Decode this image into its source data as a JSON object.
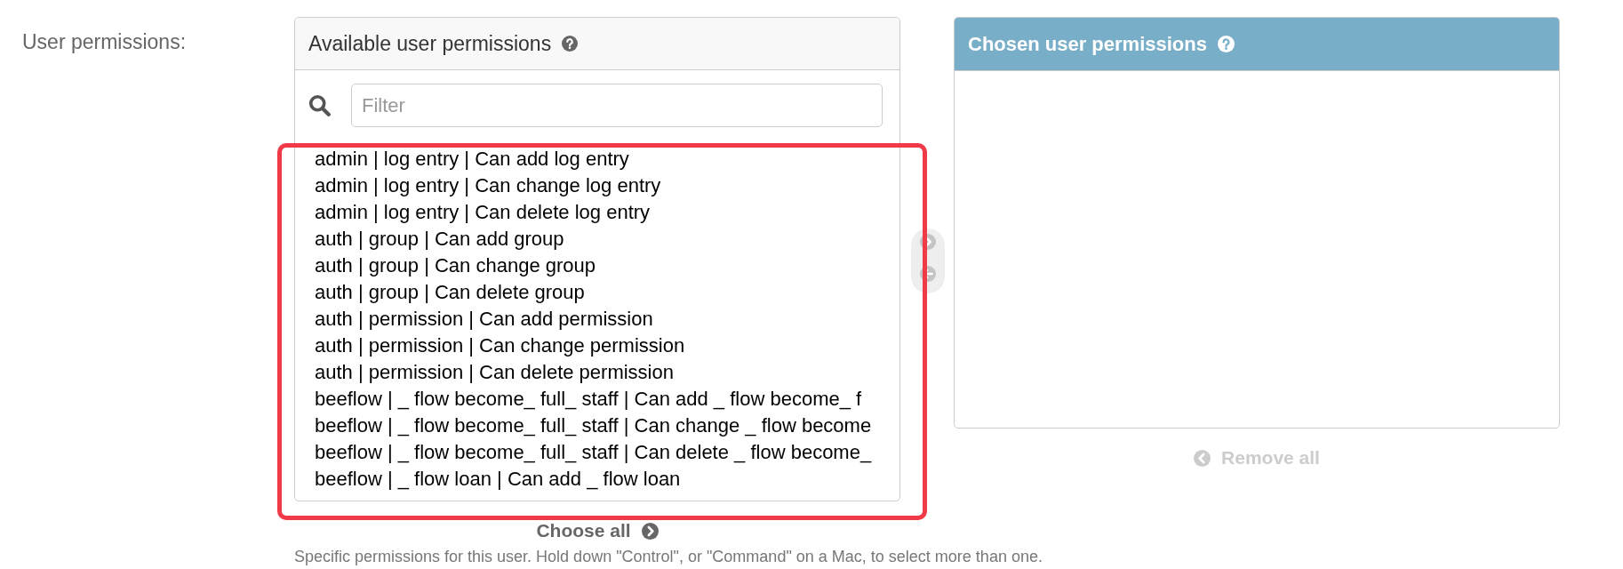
{
  "field": {
    "label": "User permissions:"
  },
  "available": {
    "title": "Available user permissions",
    "filter": {
      "placeholder": "Filter"
    },
    "options": [
      {
        "text": "admin | log entry | Can add log entry",
        "selected": false
      },
      {
        "text": "admin | log entry | Can change log entry",
        "selected": false
      },
      {
        "text": "admin | log entry | Can delete log entry",
        "selected": false
      },
      {
        "text": "auth | group | Can add group",
        "selected": false
      },
      {
        "text": "auth | group | Can change group",
        "selected": false
      },
      {
        "text": "auth | group | Can delete group",
        "selected": false
      },
      {
        "text": "auth | permission | Can add permission",
        "selected": false
      },
      {
        "text": "auth | permission | Can change permission",
        "selected": false
      },
      {
        "text": "auth | permission | Can delete permission",
        "selected": false
      },
      {
        "text": "beeflow | _ flow become_ full_ staff | Can add _ flow become_ f",
        "selected": false
      },
      {
        "text": "beeflow | _ flow become_ full_ staff | Can change _ flow become",
        "selected": false
      },
      {
        "text": "beeflow | _ flow become_ full_ staff | Can delete _ flow become_",
        "selected": false
      },
      {
        "text": "beeflow | _ flow loan | Can add _ flow loan",
        "selected": false
      }
    ],
    "choose_all": {
      "label": "Choose all",
      "disabled": false
    }
  },
  "chooser": [
    {
      "kind": "add",
      "disabled": true
    },
    {
      "kind": "remove",
      "disabled": true
    }
  ],
  "chosen": {
    "title": "Chosen user permissions",
    "remove_all": {
      "label": "Remove all",
      "disabled": true
    }
  },
  "help_text": "Specific permissions for this user. Hold down \"Control\", or \"Command\" on a Mac, to select more than one.",
  "annotation": {
    "kind": "frame"
  }
}
